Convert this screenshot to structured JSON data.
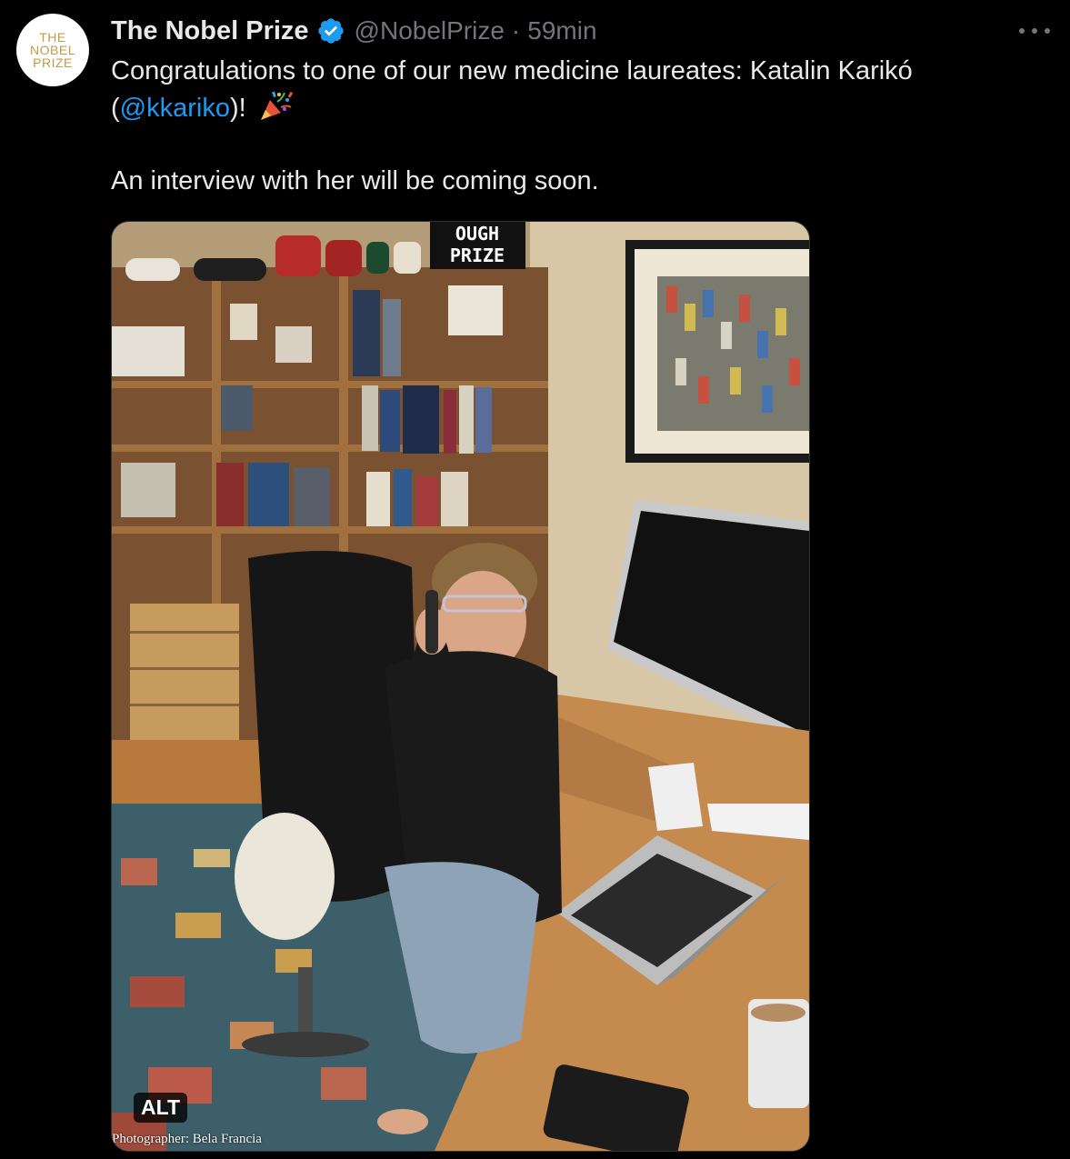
{
  "author": {
    "display_name": "The Nobel Prize",
    "handle": "@NobelPrize",
    "separator": "·",
    "time": "59min",
    "avatar_lines": [
      "THE",
      "NOBEL",
      "PRIZE"
    ],
    "avatar_icon": "nobel-prize-logo",
    "verified_icon": "verified-badge-icon"
  },
  "tweet": {
    "text_before_mention": "Congratulations to one of our new medicine laureates: Katalin Karikó (",
    "mention": "@kkariko",
    "text_after_mention": ")! ",
    "emoji": "party-popper-icon",
    "second_paragraph": "An interview with her will be coming soon."
  },
  "media": {
    "alt_badge": "ALT",
    "photo_credit": "Photographer: Bela Francia",
    "sign_lines": [
      "OUGH",
      "PRIZE"
    ],
    "description_icon": "photo-office-scene"
  },
  "menu": {
    "more_icon": "more-options-icon"
  },
  "colors": {
    "background": "#000000",
    "text_primary": "#e7e9ea",
    "text_secondary": "#71767b",
    "accent": "#1d9bf0",
    "avatar_gold": "#c39a4a"
  }
}
